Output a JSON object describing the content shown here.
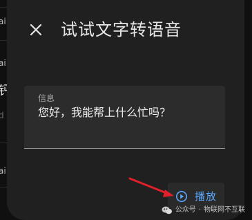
{
  "background": {
    "fragments": [
      {
        "text": "ai",
        "style": "normal"
      },
      {
        "text": "ai",
        "style": "normal"
      },
      {
        "text": "钙",
        "style": "big"
      },
      {
        "text": "d",
        "style": "dim"
      },
      {
        "text": "ai",
        "style": "normal"
      }
    ]
  },
  "dialog": {
    "title": "试试文字转语音",
    "close_icon": "close-icon"
  },
  "text_field": {
    "label": "信息",
    "value": "您好，我能帮上什么忙吗？"
  },
  "play_button": {
    "label": "播放",
    "icon": "play-circle-icon"
  },
  "watermark": {
    "source": "公众号",
    "separator": "·",
    "account": "物联网不互联"
  },
  "colors": {
    "accent": "#5aa9ff",
    "dialog_bg": "#202020",
    "field_bg": "#2c2c2c",
    "annotation_arrow": "#e0202a"
  }
}
